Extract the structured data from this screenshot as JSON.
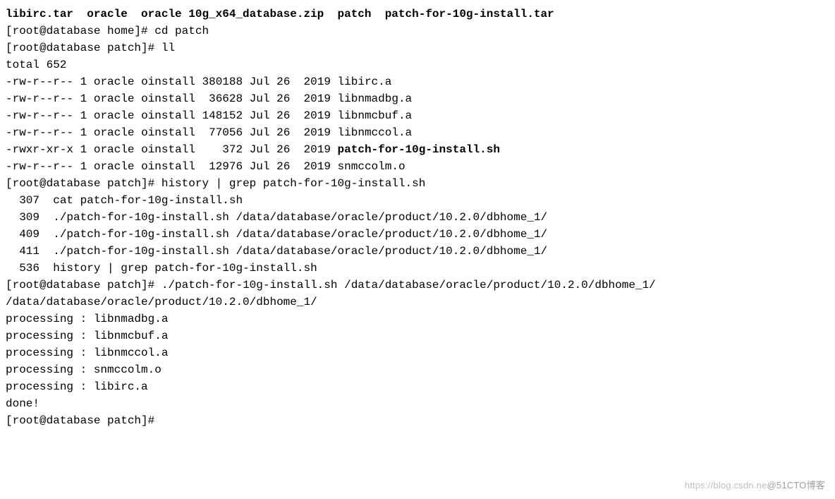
{
  "ls_top": {
    "items": [
      "libirc.tar",
      "oracle",
      "oracle 10g_x64_database.zip",
      "patch",
      "patch-for-10g-install.tar"
    ]
  },
  "prompt_home": "[root@database home]#",
  "prompt_patch": "[root@database patch]#",
  "cmd_cd": "cd patch",
  "cmd_ll": "ll",
  "total_line": "total 652",
  "ll_rows": [
    {
      "perm": "-rw-r--r--",
      "links": "1",
      "owner": "oracle",
      "group": "oinstall",
      "size": "380188",
      "date": "Jul 26  2019",
      "name": "libirc.a",
      "bold": false
    },
    {
      "perm": "-rw-r--r--",
      "links": "1",
      "owner": "oracle",
      "group": "oinstall",
      "size": " 36628",
      "date": "Jul 26  2019",
      "name": "libnmadbg.a",
      "bold": false
    },
    {
      "perm": "-rw-r--r--",
      "links": "1",
      "owner": "oracle",
      "group": "oinstall",
      "size": "148152",
      "date": "Jul 26  2019",
      "name": "libnmcbuf.a",
      "bold": false
    },
    {
      "perm": "-rw-r--r--",
      "links": "1",
      "owner": "oracle",
      "group": "oinstall",
      "size": " 77056",
      "date": "Jul 26  2019",
      "name": "libnmccol.a",
      "bold": false
    },
    {
      "perm": "-rwxr-xr-x",
      "links": "1",
      "owner": "oracle",
      "group": "oinstall",
      "size": "   372",
      "date": "Jul 26  2019",
      "name": "patch-for-10g-install.sh",
      "bold": true
    },
    {
      "perm": "-rw-r--r--",
      "links": "1",
      "owner": "oracle",
      "group": "oinstall",
      "size": " 12976",
      "date": "Jul 26  2019",
      "name": "snmccolm.o",
      "bold": false
    }
  ],
  "cmd_history": "history | grep patch-for-10g-install.sh",
  "history_rows": [
    {
      "num": "  307",
      "cmd": " cat patch-for-10g-install.sh"
    },
    {
      "num": "  309",
      "cmd": " ./patch-for-10g-install.sh /data/database/oracle/product/10.2.0/dbhome_1/"
    },
    {
      "num": "  409",
      "cmd": " ./patch-for-10g-install.sh /data/database/oracle/product/10.2.0/dbhome_1/"
    },
    {
      "num": "  411",
      "cmd": " ./patch-for-10g-install.sh /data/database/oracle/product/10.2.0/dbhome_1/"
    },
    {
      "num": "  536",
      "cmd": " history | grep patch-for-10g-install.sh"
    }
  ],
  "cmd_run": "./patch-for-10g-install.sh /data/database/oracle/product/10.2.0/dbhome_1/",
  "run_output": [
    "/data/database/oracle/product/10.2.0/dbhome_1/",
    "processing : libnmadbg.a",
    "processing : libnmcbuf.a",
    "processing : libnmccol.a",
    "processing : snmccolm.o",
    "processing : libirc.a",
    "done!"
  ],
  "watermark_left": "https://blog.csdn.ne",
  "watermark_right": "@51CTO博客"
}
